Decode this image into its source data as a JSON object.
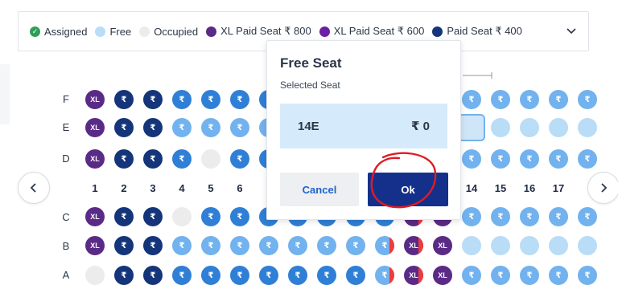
{
  "legend": {
    "items": [
      {
        "label": "Assigned",
        "color": "#2e9e58",
        "icon": "check-circle-icon"
      },
      {
        "label": "Free",
        "color": "#b9dcf7"
      },
      {
        "label": "Occupied",
        "color": "#ececec"
      },
      {
        "label": "XL Paid Seat ₹ 800",
        "color": "#5a2b86"
      },
      {
        "label": "XL Paid Seat ₹ 600",
        "color": "#6a1fa5"
      },
      {
        "label": "Paid Seat ₹ 400",
        "color": "#14357a"
      }
    ],
    "expand_icon": "chevron-down-icon"
  },
  "seatmap": {
    "columns_visible": [
      "1",
      "2",
      "3",
      "4",
      "5",
      "6",
      "14",
      "15",
      "16",
      "17"
    ],
    "rows": [
      "F",
      "E",
      "D",
      "C",
      "B",
      "A"
    ],
    "seat_symbols": {
      "xl": "XL",
      "paid": "₹"
    },
    "selected_seat_color": "#cfe6f8"
  },
  "navigation": {
    "prev_icon": "chevron-left-icon",
    "next_icon": "chevron-right-icon"
  },
  "popover": {
    "title": "Free Seat",
    "subtitle": "Selected Seat",
    "seat_number": "14E",
    "price": "₹ 0",
    "cancel_label": "Cancel",
    "ok_label": "Ok"
  },
  "colors": {
    "primary": "#15308a",
    "accent_blue": "#1f63c6",
    "annotation": "#e01b24"
  }
}
